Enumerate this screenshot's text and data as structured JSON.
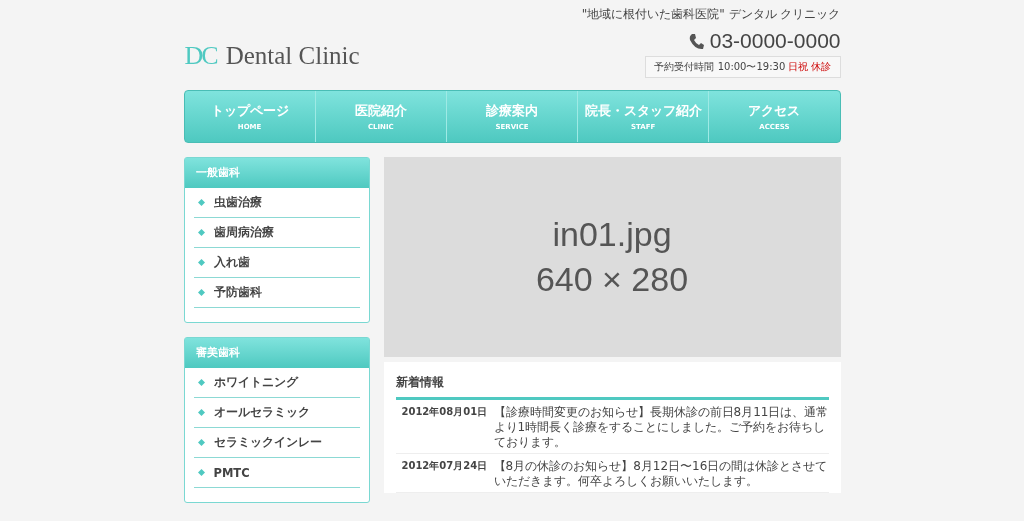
{
  "header": {
    "tagline": "\"地域に根付いた歯科医院\" デンタル クリニック",
    "logo_mark": "DC",
    "logo_text": "Dental Clinic",
    "phone": "03-0000-0000",
    "hours_label": "予約受付時間 10:00〜19:30",
    "closed_days": "日祝 休診"
  },
  "nav": [
    {
      "label": "トップページ",
      "sub": "HOME"
    },
    {
      "label": "医院紹介",
      "sub": "CLINIC"
    },
    {
      "label": "診療案内",
      "sub": "SERVICE"
    },
    {
      "label": "院長・スタッフ紹介",
      "sub": "STAFF"
    },
    {
      "label": "アクセス",
      "sub": "ACCESS"
    }
  ],
  "sidebar": [
    {
      "title": "一般歯科",
      "items": [
        "虫歯治療",
        "歯周病治療",
        "入れ歯",
        "予防歯科"
      ]
    },
    {
      "title": "審美歯科",
      "items": [
        "ホワイトニング",
        "オールセラミック",
        "セラミックインレー",
        "PMTC"
      ]
    }
  ],
  "main_image": {
    "filename": "in01.jpg",
    "size": "640 × 280"
  },
  "news": {
    "title": "新着情報",
    "items": [
      {
        "date": "2012年08月01日",
        "text": "【診療時間変更のお知らせ】長期休診の前日8月11日は、通常より1時間長く診療をすることにしました。ご予約をお待ちしております。"
      },
      {
        "date": "2012年07月24日",
        "text": "【8月の休診のお知らせ】8月12日〜16日の間は休診とさせていただきます。何卒よろしくお願いいたします。"
      }
    ]
  }
}
